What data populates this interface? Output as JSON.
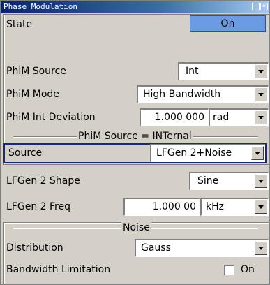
{
  "window": {
    "title": "Phase Modulation"
  },
  "state": {
    "label": "State",
    "button": "On"
  },
  "phim": {
    "source_label": "PhiM Source",
    "source_value": "Int",
    "mode_label": "PhiM Mode",
    "mode_value": "High Bandwidth",
    "deviation_label": "PhiM Int Deviation",
    "deviation_value": "1.000 000",
    "deviation_unit": "rad"
  },
  "internal_section": {
    "header": "PhiM Source = INTernal",
    "source_label": "Source",
    "source_value": "LFGen 2+Noise",
    "shape_label": "LFGen 2 Shape",
    "shape_value": "Sine",
    "freq_label": "LFGen 2 Freq",
    "freq_value": "1.000 00",
    "freq_unit": "kHz"
  },
  "noise_section": {
    "header": "Noise",
    "distribution_label": "Distribution",
    "distribution_value": "Gauss",
    "bandwidth_label": "Bandwidth Limitation",
    "bandwidth_checkbox_label": "On"
  }
}
